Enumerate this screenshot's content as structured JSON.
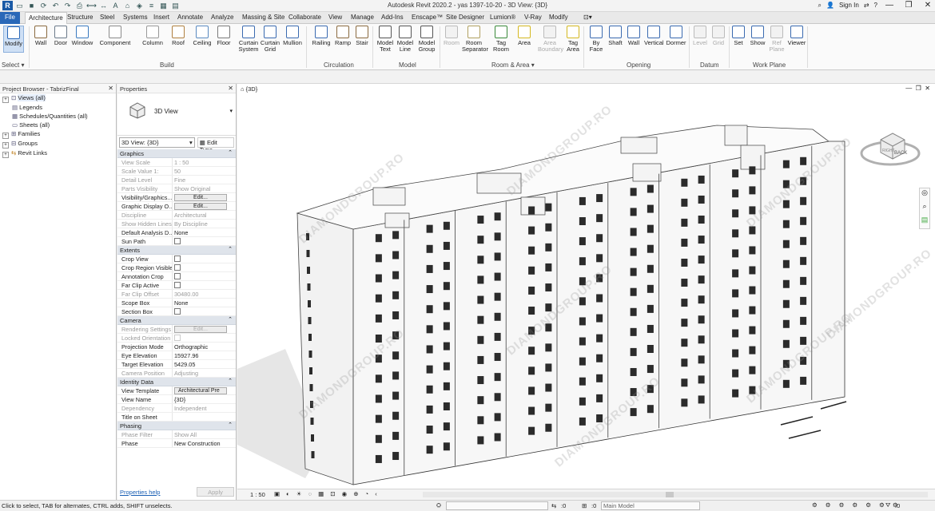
{
  "window": {
    "title": "Autodesk Revit 2020.2 - yas 1397-10-20 - 3D View: {3D}",
    "sign_in": "Sign In",
    "colors": {
      "file_tab": "#2a68b8",
      "group_header": "#dfe4eb",
      "viewport_bg": "#ffffff"
    }
  },
  "ribbon_tabs": [
    "File",
    "Architecture",
    "Structure",
    "Steel",
    "Systems",
    "Insert",
    "Annotate",
    "Analyze",
    "Massing & Site",
    "Collaborate",
    "View",
    "Manage",
    "Add-Ins",
    "Enscape™",
    "Site Designer",
    "Lumion®",
    "V-Ray",
    "Modify"
  ],
  "active_tab": "Architecture",
  "ribbon": {
    "buttons": [
      "Modify",
      "Wall",
      "Door",
      "Window",
      "Component",
      "Column",
      "Roof",
      "Ceiling",
      "Floor",
      "Curtain\nSystem",
      "Curtain\nGrid",
      "Mullion",
      "Railing",
      "Ramp",
      "Stair",
      "Model\nText",
      "Model\nLine",
      "Model\nGroup",
      "Room",
      "Room\nSeparator",
      "Tag\nRoom",
      "Area",
      "Area\nBoundary",
      "Tag\nArea",
      "By\nFace",
      "Shaft",
      "Wall",
      "Vertical",
      "Dormer",
      "Level",
      "Grid",
      "Set",
      "Show",
      "Ref\nPlane",
      "Viewer"
    ],
    "panels": [
      "Select ▾",
      "Build",
      "Circulation",
      "Model",
      "Room & Area ▾",
      "Opening",
      "Datum",
      "Work Plane"
    ]
  },
  "project_browser": {
    "title": "Project Browser - TabrizFinal",
    "items": [
      "Views (all)",
      "Legends",
      "Schedules/Quantities (all)",
      "Sheets (all)",
      "Families",
      "Groups",
      "Revit Links"
    ]
  },
  "properties": {
    "title": "Properties",
    "type_name": "3D View",
    "selector": "3D View: {3D}",
    "edit_type": "Edit Type",
    "groups": [
      {
        "name": "Graphics",
        "rows": [
          [
            "View Scale",
            "1 : 50",
            "dim"
          ],
          [
            "Scale Value    1:",
            "50",
            "dim"
          ],
          [
            "Detail Level",
            "Fine",
            "dim"
          ],
          [
            "Parts Visibility",
            "Show Original",
            "dim"
          ],
          [
            "Visibility/Graphics...",
            "Edit...",
            "btn"
          ],
          [
            "Graphic Display O...",
            "Edit...",
            "btn"
          ],
          [
            "Discipline",
            "Architectural",
            "dim"
          ],
          [
            "Show Hidden Lines",
            "By Discipline",
            "dim"
          ],
          [
            "Default Analysis D...",
            "None",
            ""
          ],
          [
            "Sun Path",
            "",
            "chk"
          ]
        ]
      },
      {
        "name": "Extents",
        "rows": [
          [
            "Crop View",
            "",
            "chk"
          ],
          [
            "Crop Region Visible",
            "",
            "chk"
          ],
          [
            "Annotation Crop",
            "",
            "chk"
          ],
          [
            "Far Clip Active",
            "",
            "chk"
          ],
          [
            "Far Clip Offset",
            "30480.00",
            "dim"
          ],
          [
            "Scope Box",
            "None",
            ""
          ],
          [
            "Section Box",
            "",
            "chk"
          ]
        ]
      },
      {
        "name": "Camera",
        "rows": [
          [
            "Rendering Settings",
            "Edit...",
            "dimbtn"
          ],
          [
            "Locked Orientation",
            "",
            "dimchk"
          ],
          [
            "Projection Mode",
            "Orthographic",
            ""
          ],
          [
            "Eye Elevation",
            "15927.96",
            ""
          ],
          [
            "Target Elevation",
            "5429.05",
            ""
          ],
          [
            "Camera Position",
            "Adjusting",
            "dim"
          ]
        ]
      },
      {
        "name": "Identity Data",
        "rows": [
          [
            "View Template",
            "Architectural Pre",
            "btn2"
          ],
          [
            "View Name",
            "{3D}",
            ""
          ],
          [
            "Dependency",
            "Independent",
            "dim"
          ],
          [
            "Title on Sheet",
            "",
            ""
          ]
        ]
      },
      {
        "name": "Phasing",
        "rows": [
          [
            "Phase Filter",
            "Show All",
            "dim"
          ],
          [
            "Phase",
            "New Construction",
            ""
          ]
        ]
      }
    ],
    "help_link": "Properties help",
    "apply": "Apply"
  },
  "view": {
    "tab": "{3D}",
    "scale": "1 : 50",
    "viewcube_front": "BACK",
    "viewcube_side": "RIGHT",
    "watermark": "DIAMONDGROUP.RO",
    "watermark_sub": "WWW.DIAMONDGROUP.RO"
  },
  "status": {
    "hint": "Click to select, TAB for alternates, CTRL adds, SHIFT unselects.",
    "zero1": ":0",
    "zero2": ":0",
    "model": "Main Model",
    "filter_count": ":0"
  }
}
